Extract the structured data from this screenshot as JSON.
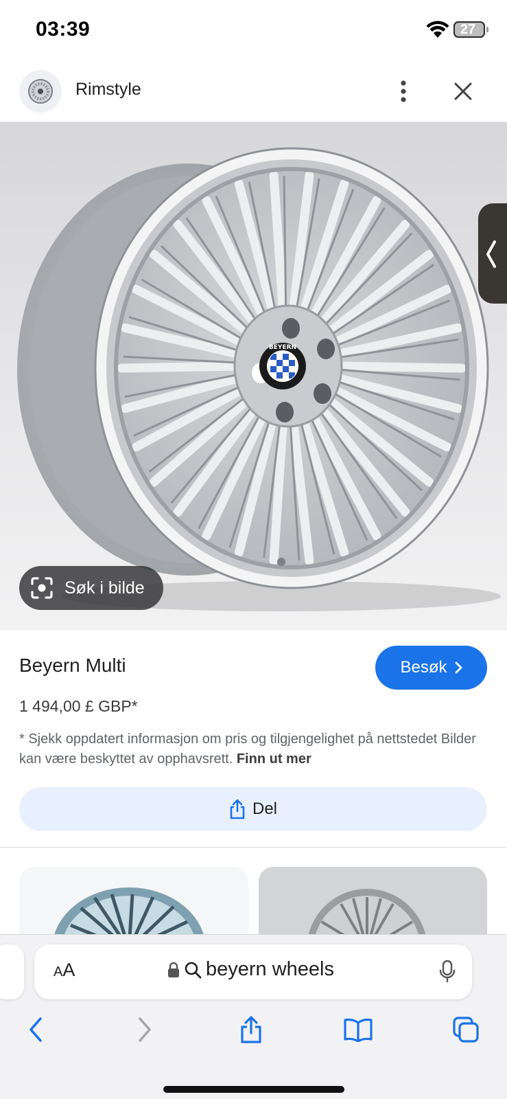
{
  "status_bar": {
    "time": "03:39",
    "battery": "27",
    "wifi_icon": "wifi-icon"
  },
  "source": {
    "name": "Rimstyle",
    "favicon_icon": "wheel-favicon-icon",
    "more_icon": "more-vertical-icon",
    "close_icon": "close-icon"
  },
  "image": {
    "lens_label": "Søk i bilde",
    "lens_icon": "lens-camera-icon",
    "next_icon": "chevron-left-icon",
    "hub_logo_text": "BEYERN"
  },
  "product": {
    "title": "Beyern Multi",
    "visit_label": "Besøk",
    "price": "1 494,00 £ GBP*",
    "disclaimer": "* Sjekk oppdatert informasjon om pris og tilgjengelighet på nettstedet Bilder kan være beskyttet av opphavsrett.",
    "learn_more": "Finn ut mer",
    "share_label": "Del"
  },
  "browser": {
    "aa_small": "A",
    "aa_large": "A",
    "address": "beyern wheels",
    "icons": [
      "lock-icon",
      "search-icon",
      "microphone-icon",
      "back-arrow-icon",
      "forward-arrow-icon",
      "share-icon",
      "bookmarks-icon",
      "tabs-icon"
    ]
  },
  "colors": {
    "accent": "#1a73e8",
    "share_bg": "#e8f0fe",
    "chrome_bg": "#f2f2f4"
  }
}
